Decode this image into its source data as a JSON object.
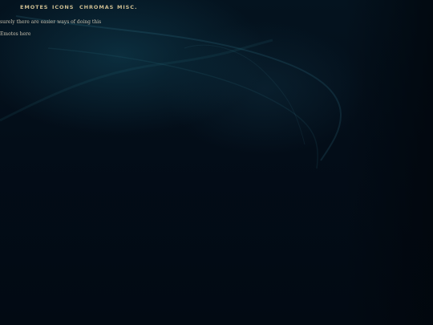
{
  "nav": {
    "tabs": [
      {
        "label": "EMOTES"
      },
      {
        "label": "ICONS"
      },
      {
        "label": "CHROMAS"
      },
      {
        "label": "MISC."
      }
    ]
  },
  "content": {
    "note": "surely there are easier ways of doing this",
    "emotes_placeholder": "Emotes here"
  },
  "theme": {
    "background": "#020a13",
    "accent_gold": "#cdbd91",
    "glow_teal": "#12465a"
  }
}
